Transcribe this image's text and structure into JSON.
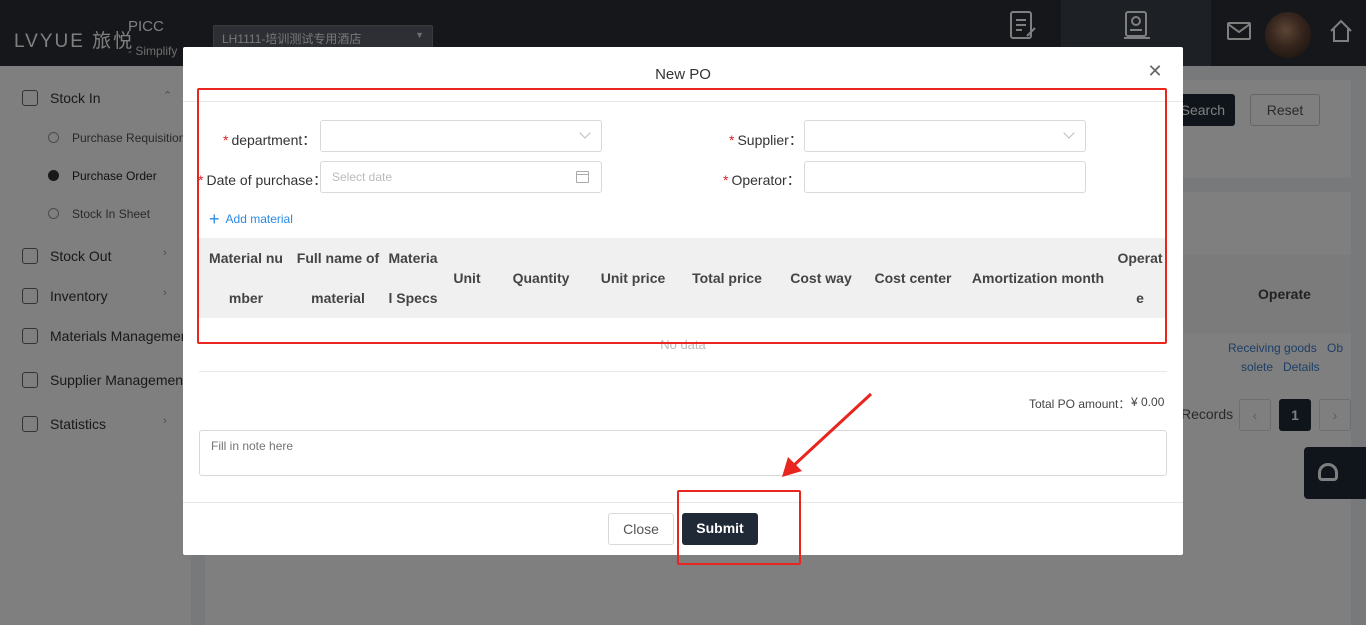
{
  "topbar": {
    "logo": "LVYUE 旅悦",
    "app_title": "PICC",
    "app_subtitle": "- Simplify",
    "hotel_select": "LH1111-培训测试专用酒店",
    "nav_1_label": "Cost Entry",
    "nav_2_label": "Purchase Order History"
  },
  "sidebar": {
    "stock_in": "Stock In",
    "purchase_requisition": "Purchase Requisition",
    "purchase_order": "Purchase Order",
    "stock_in_sheet": "Stock In Sheet",
    "stock_out": "Stock Out",
    "inventory": "Inventory",
    "materials_management": "Materials Management",
    "supplier_management": "Supplier Management",
    "statistics": "Statistics"
  },
  "background": {
    "search_label": "Search",
    "reset_label": "Reset",
    "operate_header": "Operate",
    "link_receiving": "Receiving goods",
    "link_obsolete_a": "Ob",
    "link_obsolete_b": "solete",
    "link_details": "Details",
    "records_label": "Records",
    "current_page": "1"
  },
  "modal": {
    "title": "New PO",
    "department_label": "department：",
    "supplier_label": "Supplier：",
    "date_label": "Date of purchase：",
    "operator_label": "Operator：",
    "date_placeholder": "Select date",
    "add_material": "Add material",
    "columns": {
      "material_number_1": "Material nu",
      "material_number_2": "mber",
      "full_name_1": "Full name of",
      "full_name_2": "material",
      "specs_1": "Materia",
      "specs_2": "l Specs",
      "unit": "Unit",
      "quantity": "Quantity",
      "unit_price": "Unit price",
      "total_price": "Total price",
      "cost_way": "Cost way",
      "cost_center": "Cost center",
      "amortization_month": "Amortization month",
      "operate_1": "Operat",
      "operate_2": "e"
    },
    "no_data": "No data",
    "total_label": "Total PO amount：",
    "total_value": "¥  0.00",
    "note_placeholder": "Fill in note here",
    "close_label": "Close",
    "submit_label": "Submit"
  },
  "colors": {
    "highlight": "#e8251e",
    "primary_dark": "#1f2a36",
    "link": "#2a8ae6",
    "required": "#e02020"
  }
}
